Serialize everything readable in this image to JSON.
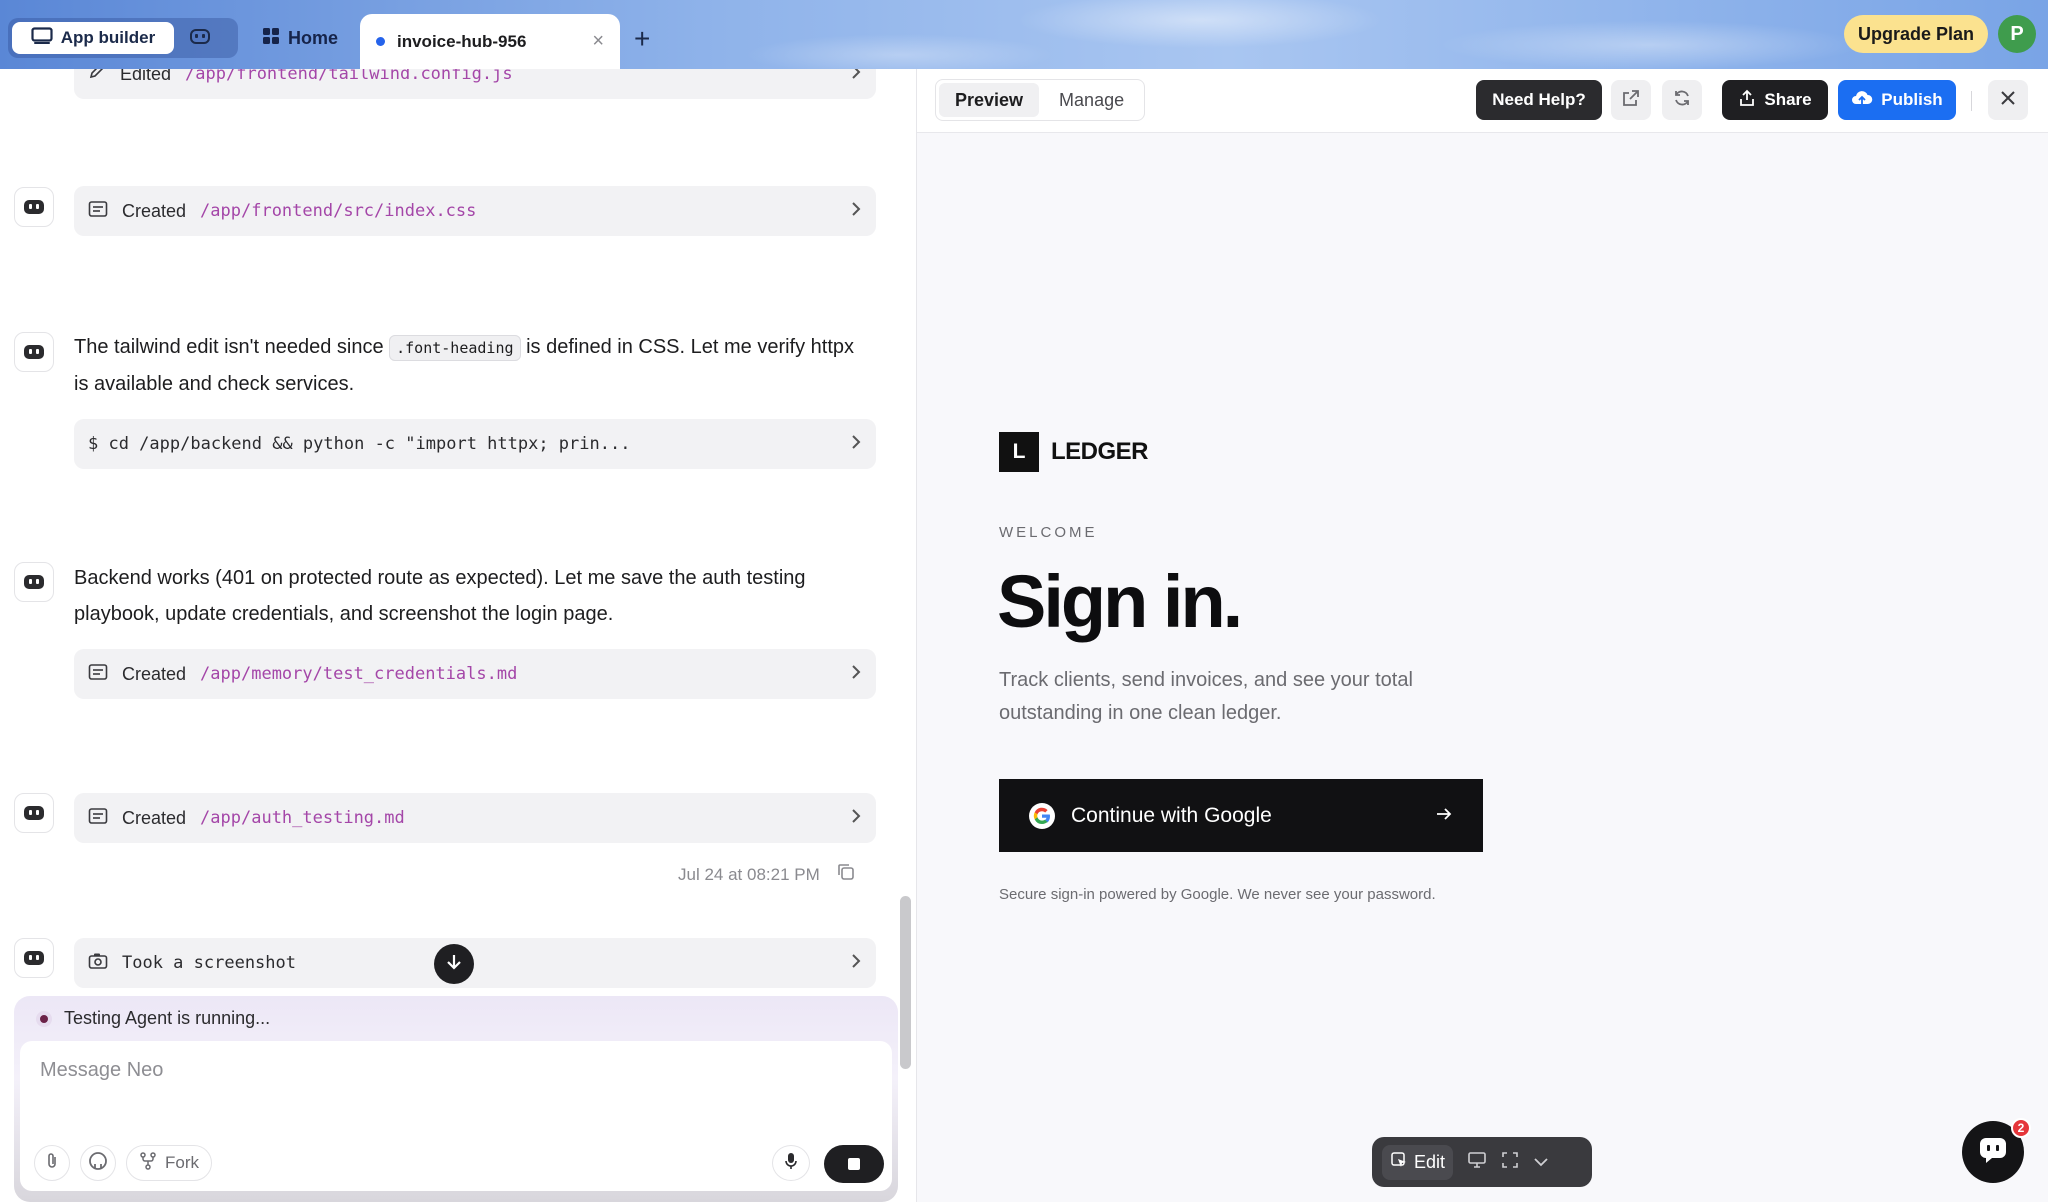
{
  "topbar": {
    "app_builder_label": "App builder",
    "home_label": "Home",
    "tab_title": "invoice-hub-956",
    "upgrade_label": "Upgrade Plan",
    "avatar_initial": "P"
  },
  "chat": {
    "items": [
      {
        "type": "tool",
        "label": "Edited",
        "path": "/app/frontend/tailwind.config.js"
      },
      {
        "type": "tool",
        "label": "Created",
        "path": "/app/frontend/src/index.css"
      },
      {
        "type": "message",
        "text_before": "The tailwind edit isn't needed since",
        "code": ".font-heading",
        "text_after": "is defined in CSS. Let me verify httpx is available and check services."
      },
      {
        "type": "command",
        "command": "$ cd /app/backend && python -c \"import httpx; prin..."
      },
      {
        "type": "message",
        "text": "Backend works (401 on protected route as expected). Let me save the auth testing playbook, update credentials, and screenshot the login page."
      },
      {
        "type": "tool",
        "label": "Created",
        "path": "/app/memory/test_credentials.md"
      },
      {
        "type": "tool",
        "label": "Created",
        "path": "/app/auth_testing.md"
      },
      {
        "type": "tool",
        "label": "Took a screenshot",
        "path": ""
      }
    ],
    "timestamp": "Jul 24 at 08:21 PM",
    "status": "Testing Agent is running...",
    "placeholder": "Message Neo",
    "fork_label": "Fork"
  },
  "preview": {
    "tabs": [
      "Preview",
      "Manage"
    ],
    "help_label": "Need Help?",
    "share_label": "Share",
    "publish_label": "Publish",
    "brand_mark": "L",
    "brand_name": "LEDGER",
    "welcome": "WELCOME",
    "heading": "Sign in.",
    "description": "Track clients, send invoices, and see your total outstanding in one clean ledger.",
    "google_button": "Continue with Google",
    "secure_note": "Secure sign-in powered by Google. We never see your password.",
    "edit_label": "Edit",
    "notification_count": "2"
  },
  "colors": {
    "accent": "#1b6ef2",
    "path_text": "#a446a8",
    "upgrade": "#fbe28f"
  }
}
